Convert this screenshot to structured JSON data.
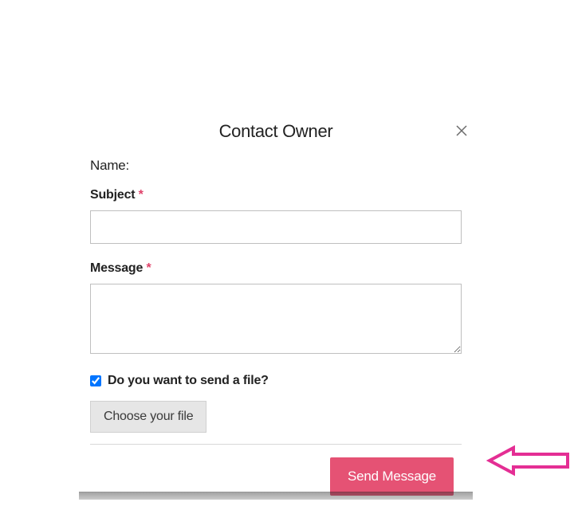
{
  "modal": {
    "title": "Contact Owner",
    "name_label": "Name:",
    "subject": {
      "label": "Subject",
      "required": "*",
      "value": ""
    },
    "message": {
      "label": "Message",
      "required": "*",
      "value": ""
    },
    "file_checkbox": {
      "label": "Do you want to send a file?",
      "checked": true
    },
    "file_button_label": "Choose your file",
    "send_label": "Send Message"
  },
  "colors": {
    "accent": "#e55274",
    "arrow": "#e42e94"
  }
}
